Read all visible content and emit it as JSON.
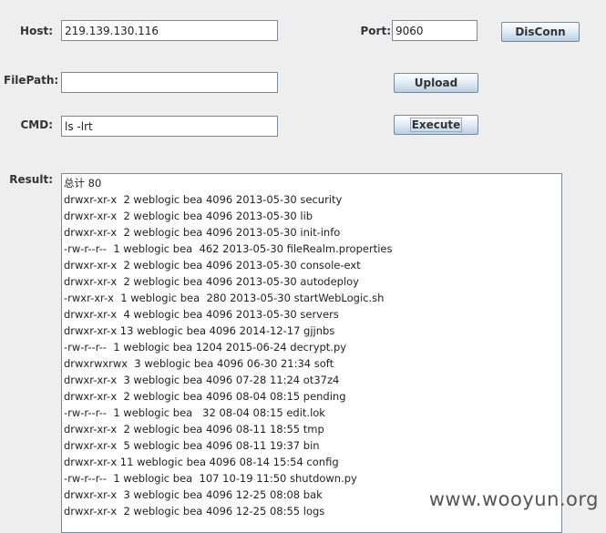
{
  "form": {
    "host_label": "Host:",
    "host_value": "219.139.130.116",
    "port_label": "Port:",
    "port_value": "9060",
    "disconn_label": "DisConn",
    "filepath_label": "FilePath:",
    "filepath_value": "",
    "upload_label": "Upload",
    "cmd_label": "CMD:",
    "cmd_value": "ls -lrt",
    "execute_label": "Execute",
    "result_label": "Result:"
  },
  "result_lines": [
    "总计 80",
    "drwxr-xr-x  2 weblogic bea 4096 2013-05-30 security",
    "drwxr-xr-x  2 weblogic bea 4096 2013-05-30 lib",
    "drwxr-xr-x  2 weblogic bea 4096 2013-05-30 init-info",
    "-rw-r--r--  1 weblogic bea  462 2013-05-30 fileRealm.properties",
    "drwxr-xr-x  2 weblogic bea 4096 2013-05-30 console-ext",
    "drwxr-xr-x  2 weblogic bea 4096 2013-05-30 autodeploy",
    "-rwxr-xr-x  1 weblogic bea  280 2013-05-30 startWebLogic.sh",
    "drwxr-xr-x  4 weblogic bea 4096 2013-05-30 servers",
    "drwxr-xr-x 13 weblogic bea 4096 2014-12-17 gjjnbs",
    "-rw-r--r--  1 weblogic bea 1204 2015-06-24 decrypt.py",
    "drwxrwxrwx  3 weblogic bea 4096 06-30 21:34 soft",
    "drwxr-xr-x  3 weblogic bea 4096 07-28 11:24 ot37z4",
    "drwxr-xr-x  2 weblogic bea 4096 08-04 08:15 pending",
    "-rw-r--r--  1 weblogic bea   32 08-04 08:15 edit.lok",
    "drwxr-xr-x  2 weblogic bea 4096 08-11 18:55 tmp",
    "drwxr-xr-x  5 weblogic bea 4096 08-11 19:37 bin",
    "drwxr-xr-x 11 weblogic bea 4096 08-14 15:54 config",
    "-rw-r--r--  1 weblogic bea  107 10-19 11:50 shutdown.py",
    "drwxr-xr-x  3 weblogic bea 4096 12-25 08:08 bak",
    "drwxr-xr-x  2 weblogic bea 4096 12-25 08:55 logs"
  ],
  "watermark": "www.wooyun.org"
}
